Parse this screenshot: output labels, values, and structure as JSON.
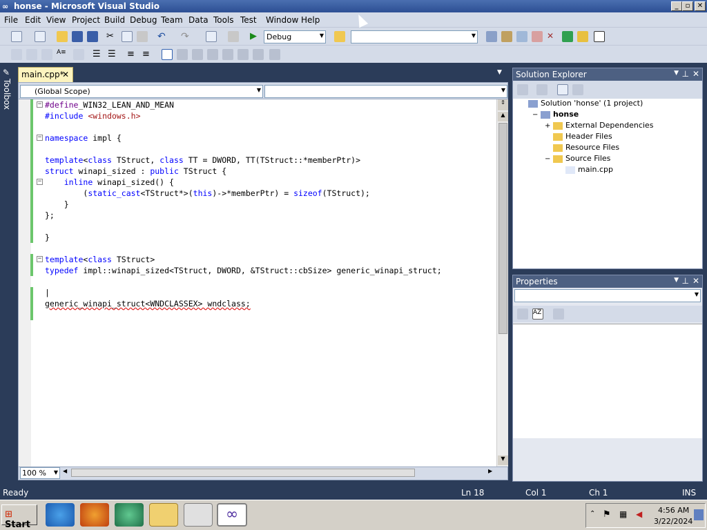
{
  "window": {
    "title": "honse - Microsoft Visual Studio",
    "min": "_",
    "max": "▫",
    "close": "✕"
  },
  "menu": [
    "File",
    "Edit",
    "View",
    "Project",
    "Build",
    "Debug",
    "Team",
    "Data",
    "Tools",
    "Test",
    "Window",
    "Help"
  ],
  "toolbar": {
    "config": "Debug",
    "platform": ""
  },
  "toolbox": {
    "label": "Toolbox"
  },
  "tab": {
    "label": "main.cpp*",
    "close": "✕"
  },
  "scope": {
    "left": "(Global Scope)",
    "right": ""
  },
  "code": [
    {
      "t": [
        [
          "mac",
          "#define"
        ],
        [
          "",
          "_WIN32_LEAN_AND_MEAN"
        ]
      ],
      "fold": true,
      "chg": true
    },
    {
      "t": [
        [
          "kw",
          "#include"
        ],
        [
          "",
          " "
        ],
        [
          "str",
          "<windows.h>"
        ]
      ],
      "chg": true
    },
    {
      "t": [],
      "chg": true
    },
    {
      "t": [
        [
          "kw",
          "namespace"
        ],
        [
          "",
          " impl {"
        ]
      ],
      "fold": true,
      "chg": true
    },
    {
      "t": [],
      "chg": true
    },
    {
      "t": [
        [
          "kw",
          "template"
        ],
        [
          "",
          "<"
        ],
        [
          "kw",
          "class"
        ],
        [
          "",
          " TStruct, "
        ],
        [
          "kw",
          "class"
        ],
        [
          "",
          " TT = DWORD, TT(TStruct::*memberPtr)>"
        ]
      ],
      "chg": true
    },
    {
      "t": [
        [
          "kw",
          "struct"
        ],
        [
          "",
          " winapi_sized : "
        ],
        [
          "kw",
          "public"
        ],
        [
          "",
          " TStruct {"
        ]
      ],
      "chg": true
    },
    {
      "t": [
        [
          "",
          "    "
        ],
        [
          "kw",
          "inline"
        ],
        [
          "",
          " winapi_sized() {"
        ]
      ],
      "fold": true,
      "chg": true
    },
    {
      "t": [
        [
          "",
          "        ("
        ],
        [
          "kw",
          "static_cast"
        ],
        [
          "",
          "<TStruct*>("
        ],
        [
          "kw",
          "this"
        ],
        [
          "",
          ")->*memberPtr) = "
        ],
        [
          "kw",
          "sizeof"
        ],
        [
          "",
          "(TStruct);"
        ]
      ],
      "chg": true
    },
    {
      "t": [
        [
          "",
          "    }"
        ]
      ],
      "chg": true
    },
    {
      "t": [
        [
          "",
          "};"
        ]
      ],
      "chg": true
    },
    {
      "t": [],
      "chg": true
    },
    {
      "t": [
        [
          "",
          "}"
        ]
      ],
      "chg": true
    },
    {
      "t": [],
      "chg": false
    },
    {
      "t": [
        [
          "kw",
          "template"
        ],
        [
          "",
          "<"
        ],
        [
          "kw",
          "class"
        ],
        [
          "",
          " TStruct>"
        ]
      ],
      "fold": true,
      "chg": true
    },
    {
      "t": [
        [
          "kw",
          "typedef"
        ],
        [
          "",
          " impl::winapi_sized<TStruct, DWORD, &TStruct::cbSize> generic_winapi_struct;"
        ]
      ],
      "chg": true
    },
    {
      "t": [],
      "chg": false
    },
    {
      "t": [
        [
          "",
          "|"
        ]
      ],
      "chg": true
    },
    {
      "t": [
        [
          "",
          "generic_winapi_struct<WNDCLASSEX> wndclass;"
        ]
      ],
      "chg": true
    },
    {
      "t": [],
      "chg": true
    }
  ],
  "zoom": "100 %",
  "solution_explorer": {
    "title": "Solution Explorer",
    "items": [
      {
        "label": "Solution 'honse' (1 project)",
        "indent": 0,
        "exp": ""
      },
      {
        "label": "honse",
        "indent": 1,
        "exp": "−",
        "bold": true
      },
      {
        "label": "External Dependencies",
        "indent": 2,
        "exp": "+"
      },
      {
        "label": "Header Files",
        "indent": 2,
        "exp": ""
      },
      {
        "label": "Resource Files",
        "indent": 2,
        "exp": ""
      },
      {
        "label": "Source Files",
        "indent": 2,
        "exp": "−"
      },
      {
        "label": "main.cpp",
        "indent": 3,
        "exp": ""
      }
    ]
  },
  "properties": {
    "title": "Properties"
  },
  "status": {
    "ready": "Ready",
    "ln": "Ln 18",
    "col": "Col 1",
    "ch": "Ch 1",
    "ins": "INS"
  },
  "taskbar": {
    "start": "Start",
    "time": "4:56 AM",
    "date": "3/22/2024"
  }
}
